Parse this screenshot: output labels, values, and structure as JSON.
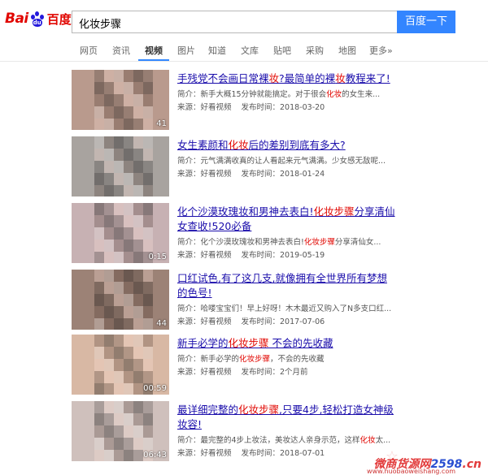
{
  "header": {
    "logo_text_en": "Bai",
    "logo_text_paw": "du",
    "logo_text_cn": "百度",
    "search_query": "化妆步骤",
    "search_button": "百度一下"
  },
  "tabs": [
    {
      "label": "网页",
      "active": false
    },
    {
      "label": "资讯",
      "active": false
    },
    {
      "label": "视频",
      "active": true
    },
    {
      "label": "图片",
      "active": false
    },
    {
      "label": "知道",
      "active": false
    },
    {
      "label": "文库",
      "active": false
    },
    {
      "label": "贴吧",
      "active": false
    },
    {
      "label": "采购",
      "active": false
    },
    {
      "label": "地图",
      "active": false
    },
    {
      "label": "更多»",
      "active": false
    }
  ],
  "results": [
    {
      "title_parts": [
        [
          "手残党不会画日常裸",
          false
        ],
        [
          "妆",
          true
        ],
        [
          "?最简单的裸",
          false
        ],
        [
          "妆",
          true
        ],
        [
          "教程来了!",
          false
        ]
      ],
      "summary_parts": [
        [
          "简介：新手大概15分钟就能搞定。对于很会",
          false
        ],
        [
          "化妆",
          true
        ],
        [
          "的女生来...",
          false
        ]
      ],
      "source": "来源：好看视频",
      "date": "发布时间：2018-03-20",
      "duration": "41",
      "tint": "#b99a8d"
    },
    {
      "title_parts": [
        [
          "女生素颜和",
          false
        ],
        [
          "化妆",
          true
        ],
        [
          "后的差别到底有多大?",
          false
        ]
      ],
      "summary_parts": [
        [
          "简介：元气满满收真的让人看起来元气满满。少女感无敌呢...",
          false
        ]
      ],
      "source": "来源：好看视频",
      "date": "发布时间：2018-01-24",
      "duration": "",
      "tint": "#a8a39f"
    },
    {
      "title_parts": [
        [
          "化个沙漠玫瑰妆和男神去表白!",
          false
        ],
        [
          "化妆步骤",
          true
        ],
        [
          "分享清仙女查收!520必备",
          false
        ]
      ],
      "summary_parts": [
        [
          "简介：化个沙漠玫瑰妆和男神去表白!",
          false
        ],
        [
          "化妆步骤",
          true
        ],
        [
          "分享清仙女...",
          false
        ]
      ],
      "source": "来源：好看视频",
      "date": "发布时间：2019-05-19",
      "duration": "0:15",
      "tint": "#c7b1b3"
    },
    {
      "title_parts": [
        [
          "口红试色,有了这几支,就像拥有全世界所有梦想的色号!",
          false
        ]
      ],
      "summary_parts": [
        [
          "简介：哈喽宝宝们！早上好呀！木木最近又购入了N多支口红...",
          false
        ]
      ],
      "source": "来源：好看视频",
      "date": "发布时间：2017-07-06",
      "duration": "44",
      "tint": "#9c8276"
    },
    {
      "title_parts": [
        [
          "新手必学的",
          false
        ],
        [
          "化妆步骤",
          true
        ],
        [
          " 不会的先收藏",
          false
        ]
      ],
      "summary_parts": [
        [
          "简介：新手必学的",
          false
        ],
        [
          "化妆步骤",
          true
        ],
        [
          "，不会的先收藏",
          false
        ]
      ],
      "source": "来源：好看视频",
      "date": "发布时间：2个月前",
      "duration": "00:59",
      "tint": "#d8b8a4"
    },
    {
      "title_parts": [
        [
          "最详细完整的",
          false
        ],
        [
          "化妆步骤",
          true
        ],
        [
          ",只要4步,轻松打造女神级妆容!",
          false
        ]
      ],
      "summary_parts": [
        [
          "简介：最完整的4步上妆法，美妆达人亲身示范，这样",
          false
        ],
        [
          "化妆",
          true
        ],
        [
          "太...",
          false
        ]
      ],
      "source": "来源：好看视频",
      "date": "发布时间：2018-07-01",
      "duration": "06:43",
      "tint": "#cfc0bc"
    }
  ],
  "watermark": {
    "main_red": "微商货源网",
    "main_blue": "2598",
    "main_tail": ".cn",
    "sub": "www.huobaoweishang.com"
  },
  "colors": {
    "accent": "#3385ff",
    "brand_red": "#e10601",
    "link": "#1a0dab"
  }
}
